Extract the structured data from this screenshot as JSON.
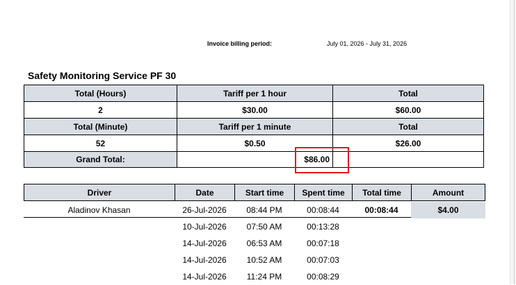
{
  "invoice": {
    "billing_period_label": "Invoice billing period:",
    "billing_period_value": "July 01, 2026 - July 31, 2026"
  },
  "service": {
    "title": "Safety Monitoring Service PF 30",
    "hours_row": {
      "headers": [
        "Total (Hours)",
        "Tariff per 1 hour",
        "Total"
      ],
      "values": [
        "2",
        "$30.00",
        "$60.00"
      ]
    },
    "minutes_row": {
      "headers": [
        "Total (Minute)",
        "Tariff per 1 minute",
        "Total"
      ],
      "values": [
        "52",
        "$0.50",
        "$26.00"
      ]
    },
    "grand_total_label": "Grand Total:",
    "grand_total_value": "$86.00",
    "highlight_color": "#e0191f"
  },
  "detail": {
    "columns": [
      "Driver",
      "Date",
      "Start time",
      "Spent time",
      "Total time",
      "Amount"
    ],
    "rows": [
      {
        "driver": "Aladinov Khasan",
        "date": "26-Jul-2026",
        "start": "08:44 PM",
        "spent": "00:08:44",
        "total": "00:08:44",
        "amount": "$4.00"
      },
      {
        "driver": "",
        "date": "10-Jul-2026",
        "start": "07:50 AM",
        "spent": "00:13:28",
        "total": "",
        "amount": ""
      },
      {
        "driver": "",
        "date": "14-Jul-2026",
        "start": "06:53 AM",
        "spent": "00:07:18",
        "total": "",
        "amount": ""
      },
      {
        "driver": "",
        "date": "14-Jul-2026",
        "start": "10:52 AM",
        "spent": "00:07:03",
        "total": "",
        "amount": ""
      },
      {
        "driver": "",
        "date": "14-Jul-2026",
        "start": "11:24 PM",
        "spent": "00:08:29",
        "total": "",
        "amount": ""
      }
    ]
  },
  "colors": {
    "header_fill": "#d9dde4",
    "border": "#000000"
  }
}
